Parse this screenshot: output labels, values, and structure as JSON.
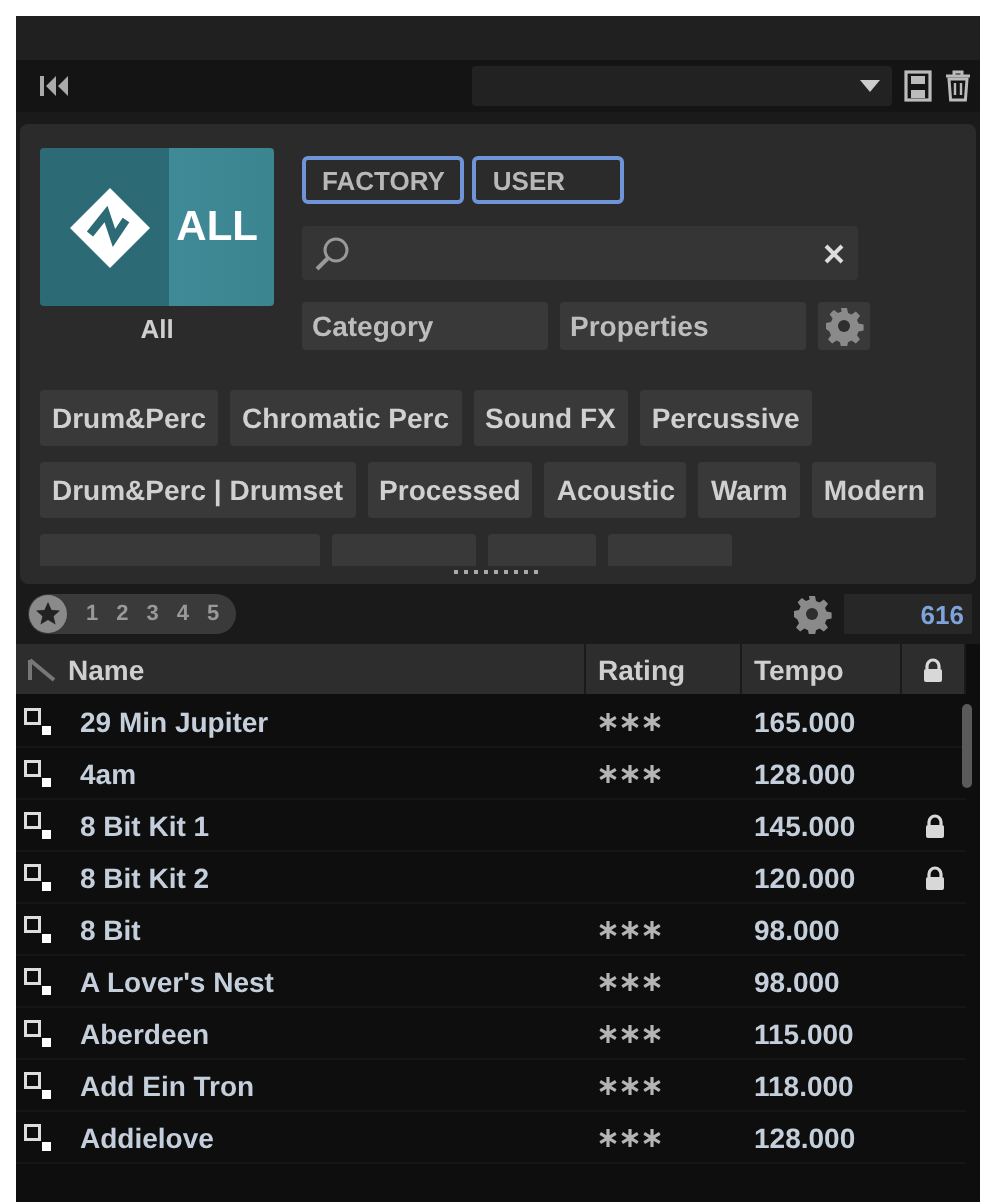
{
  "logo": {
    "badge": "ALL",
    "caption": "All"
  },
  "source_buttons": [
    {
      "label": "FACTORY",
      "selected": true
    },
    {
      "label": "USER",
      "selected": true
    }
  ],
  "filters": [
    "Category",
    "Properties"
  ],
  "tag_rows": [
    [
      "Drum&Perc",
      "Chromatic Perc",
      "Sound FX",
      "Percussive"
    ],
    [
      "Drum&Perc | Drumset",
      "Processed",
      "Acoustic",
      "Warm",
      "Modern"
    ]
  ],
  "rating_filter": [
    "1",
    "2",
    "3",
    "4",
    "5"
  ],
  "result_count": "616",
  "table": {
    "columns": [
      "Name",
      "Rating",
      "Tempo"
    ],
    "rows": [
      {
        "name": "29 Min Jupiter",
        "stars": 3,
        "tempo": "165.000",
        "locked": false
      },
      {
        "name": "4am",
        "stars": 3,
        "tempo": "128.000",
        "locked": false
      },
      {
        "name": "8 Bit Kit 1",
        "tempo": "145.000",
        "locked": true
      },
      {
        "name": "8 Bit Kit 2",
        "tempo": "120.000",
        "locked": true
      },
      {
        "name": "8 Bit",
        "stars": 3,
        "tempo": "98.000",
        "locked": false
      },
      {
        "name": "A Lover's Nest",
        "stars": 3,
        "tempo": "98.000",
        "locked": false
      },
      {
        "name": "Aberdeen",
        "stars": 3,
        "tempo": "115.000",
        "locked": false
      },
      {
        "name": "Add Ein Tron",
        "stars": 3,
        "tempo": "118.000",
        "locked": false
      },
      {
        "name": "Addielove",
        "stars": 3,
        "tempo": "128.000",
        "locked": false
      }
    ]
  }
}
